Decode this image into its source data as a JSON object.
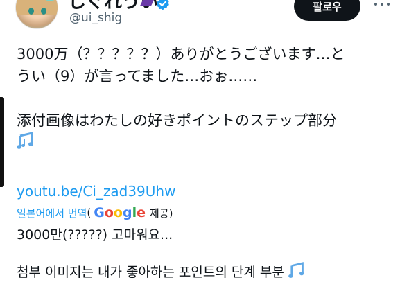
{
  "author": {
    "display_name": "しぐれうい",
    "handle": "@ui_shig",
    "verified_icon": "verified-badge-icon"
  },
  "actions": {
    "follow_label": "팔로우",
    "more_icon": "more-dots-icon"
  },
  "tweet": {
    "line1": "3000万（？？？？？）ありがとうございます…と",
    "line2": "うい（9）が言ってました…おぉ……",
    "line3": "添付画像はわたしの好きポイントのステップ部分",
    "link": "youtu.be/Ci_zad39Uhw"
  },
  "translation": {
    "label": "일본어에서 번역",
    "paren_open": "(",
    "provider_suffix": "제공)",
    "line1": "3000만(?????) 고마워요...",
    "line2": "첨부 이미지는 내가 좋아하는 포인트의 단계 부분"
  },
  "colors": {
    "link": "#1d9bf0",
    "text": "#0f1419",
    "muted": "#536471",
    "follow_bg": "#0f1419"
  }
}
